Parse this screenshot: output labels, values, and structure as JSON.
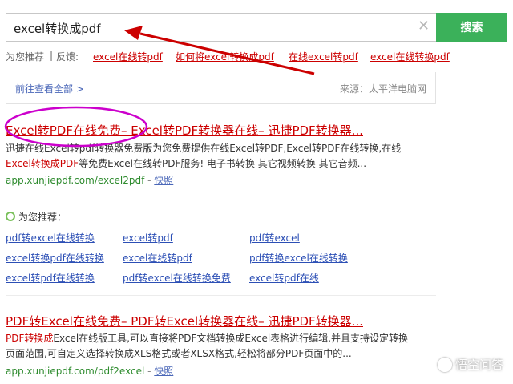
{
  "search": {
    "query": "excel转换成pdf",
    "button_label": "搜索"
  },
  "recommend_row": {
    "prefix": "为您推荐",
    "separator": "|",
    "feedback": "反馈:",
    "items": [
      "excel在线转pdf",
      "如何将excel转换成pdf",
      "在线excel转pdf",
      "excel在线转换pdf"
    ]
  },
  "info_box": {
    "link": "前往查看全部 >",
    "source": "来源：太平洋电脑网"
  },
  "result1": {
    "title": "Excel转PDF在线免费– Excel转PDF转换器在线– 迅捷PDF转换器...",
    "desc_line1": "迅捷在线Excel转pdf转换器免费版为您免费提供在线Excel转PDF,Excel转PDF在线转换,在线",
    "desc_line2_hl": "Excel转换成PDF",
    "desc_line2_rest": "等免费Excel在线转PDF服务! 电子书转换 其它视频转换 其它音频...",
    "url": "app.xunjiepdf.com/excel2pdf",
    "sep": " - ",
    "snapshot": "快照"
  },
  "recommend_block": {
    "heading": "为您推荐：",
    "links": [
      [
        "pdf转excel在线转换",
        "excel转pdf",
        "pdf转excel"
      ],
      [
        "excel转换pdf在线转换",
        "excel在线转pdf",
        "pdf转换excel在线转换"
      ],
      [
        "excel转pdf在线转换",
        "pdf转excel在线转换免费",
        "excel转pdf在线"
      ]
    ]
  },
  "result2": {
    "title": "PDF转Excel在线免费– PDF转Excel转换器在线– 迅捷PDF转换器...",
    "desc_line1_hl": "PDF转换成",
    "desc_line1_rest": "Excel在线版工具,可以直接将PDF文档转换成Excel表格进行编辑,并且支持设定转换",
    "desc_line2": "页面范围,可自定义选择转换成XLS格式或者XLSX格式,轻松将部分PDF页面中的...",
    "url": "app.xunjiepdf.com/pdf2excel",
    "sep": " - ",
    "snapshot": "快照"
  },
  "watermark": {
    "text": "悟空问答"
  },
  "colors": {
    "accent_green": "#3bb15a",
    "link_red": "#cc0000",
    "link_blue": "#2c4fb5",
    "url_green": "#2e8b2e",
    "annotation": "#cc00cc"
  }
}
